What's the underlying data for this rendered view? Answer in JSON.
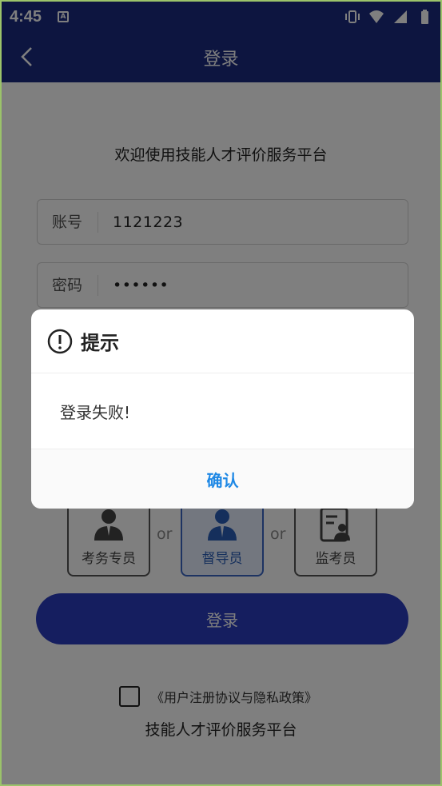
{
  "status_bar": {
    "time": "4:45",
    "notif_letter": "A"
  },
  "header": {
    "title": "登录"
  },
  "welcome": "欢迎使用技能人才评价服务平台",
  "fields": {
    "account_label": "账号",
    "account_value": "1121223",
    "password_label": "密码",
    "password_value": "••••••"
  },
  "roles": [
    {
      "label": "考务专员",
      "selected": false
    },
    {
      "label": "督导员",
      "selected": true
    },
    {
      "label": "监考员",
      "selected": false
    }
  ],
  "or_text": "or",
  "login_button": "登录",
  "agreement": "《用户注册协议与隐私政策》",
  "footer": "技能人才评价服务平台",
  "dialog": {
    "title": "提示",
    "message": "登录失败!",
    "confirm": "确认"
  },
  "colors": {
    "primary": "#2a3cbf",
    "header": "#1a2a80",
    "link": "#1e88e5"
  }
}
